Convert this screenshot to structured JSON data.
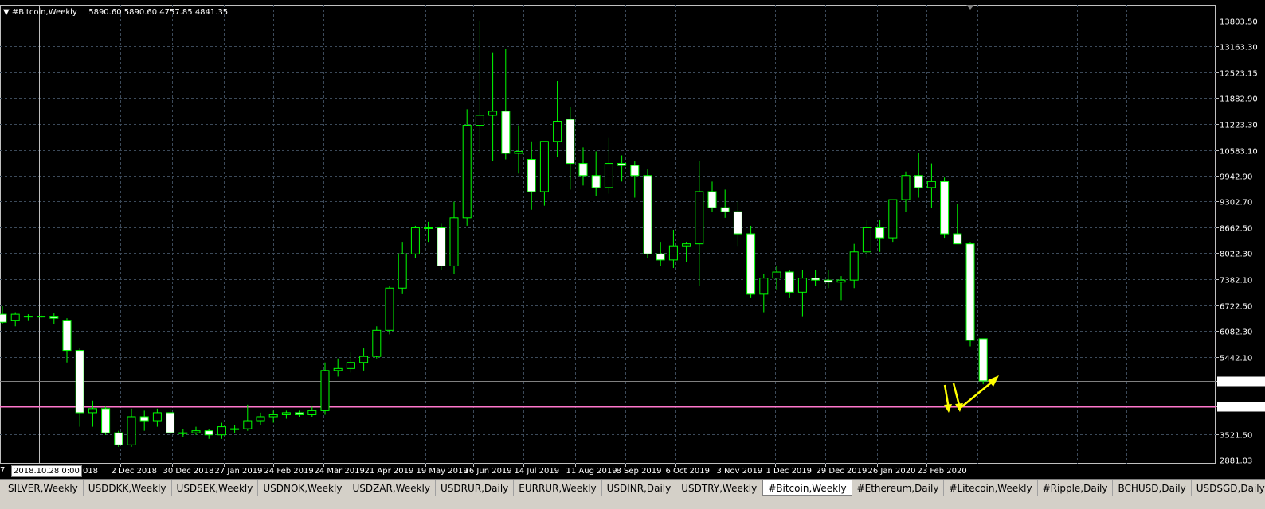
{
  "header": {
    "menu_arrow": "▼",
    "symbol": "#Bitcoin,Weekly",
    "ohlc": "5890.60 5890.60 4757.85 4841.35"
  },
  "crosshair": {
    "time_label": "2018.10.28 0:00",
    "left_cut_label": "7"
  },
  "tabs": [
    {
      "label": "SILVER,Weekly",
      "active": false
    },
    {
      "label": "USDDKK,Weekly",
      "active": false
    },
    {
      "label": "USDSEK,Weekly",
      "active": false
    },
    {
      "label": "USDNOK,Weekly",
      "active": false
    },
    {
      "label": "USDZAR,Weekly",
      "active": false
    },
    {
      "label": "USDRUR,Daily",
      "active": false
    },
    {
      "label": "EURRUR,Weekly",
      "active": false
    },
    {
      "label": "USDINR,Daily",
      "active": false
    },
    {
      "label": "USDTRY,Weekly",
      "active": false
    },
    {
      "label": "#Bitcoin,Weekly",
      "active": true
    },
    {
      "label": "#Ethereum,Daily",
      "active": false
    },
    {
      "label": "#Litecoin,Weekly",
      "active": false
    },
    {
      "label": "#Ripple,Daily",
      "active": false
    },
    {
      "label": "BCHUSD,Daily",
      "active": false
    },
    {
      "label": "USDSGD,Daily",
      "active": false
    }
  ],
  "colors": {
    "background": "#000000",
    "grid": "#3c4a5a",
    "bull_candle": "#000000",
    "bear_candle": "#ffffff",
    "wick": "#00ff00",
    "support_line": "#ff77cc",
    "price_line": "#808080",
    "arrows": "#ffff00"
  },
  "chart_data": {
    "type": "candlestick",
    "symbol": "#Bitcoin",
    "timeframe": "Weekly",
    "ylim": [
      2881.03,
      14000
    ],
    "y_ticks": [
      "13803.50",
      "13163.30",
      "12523.15",
      "11882.90",
      "11223.30",
      "10583.10",
      "9942.90",
      "9302.70",
      "8662.50",
      "8022.30",
      "7382.10",
      "6722.50",
      "6082.30",
      "5442.10",
      "4841.35",
      "4206.83",
      "3521.50",
      "2881.03"
    ],
    "x_ticks": [
      "v 2018",
      "2 Dec 2018",
      "30 Dec 2018",
      "27 Jan 2019",
      "24 Feb 2019",
      "24 Mar 2019",
      "21 Apr 2019",
      "19 May 2019",
      "16 Jun 2019",
      "14 Jul 2019",
      "11 Aug 2019",
      "8 Sep 2019",
      "6 Oct 2019",
      "3 Nov 2019",
      "1 Dec 2019",
      "29 Dec 2019",
      "26 Jan 2020",
      "23 Feb 2020"
    ],
    "current_price": 4841.35,
    "horizontal_line": 4206.83,
    "grid": true,
    "candles": [
      {
        "o": 6500,
        "h": 6700,
        "l": 6250,
        "c": 6300
      },
      {
        "o": 6350,
        "h": 6550,
        "l": 6200,
        "c": 6500
      },
      {
        "o": 6450,
        "h": 6500,
        "l": 6350,
        "c": 6450
      },
      {
        "o": 6450,
        "h": 6500,
        "l": 6400,
        "c": 6430
      },
      {
        "o": 6450,
        "h": 6520,
        "l": 6250,
        "c": 6400
      },
      {
        "o": 6350,
        "h": 6400,
        "l": 5300,
        "c": 5600
      },
      {
        "o": 5600,
        "h": 5650,
        "l": 3700,
        "c": 4050
      },
      {
        "o": 4050,
        "h": 4350,
        "l": 3700,
        "c": 4150
      },
      {
        "o": 4150,
        "h": 4200,
        "l": 3500,
        "c": 3550
      },
      {
        "o": 3550,
        "h": 3600,
        "l": 3200,
        "c": 3250
      },
      {
        "o": 3250,
        "h": 4150,
        "l": 3200,
        "c": 3950
      },
      {
        "o": 3950,
        "h": 4100,
        "l": 3600,
        "c": 3850
      },
      {
        "o": 3850,
        "h": 4150,
        "l": 3700,
        "c": 4050
      },
      {
        "o": 4050,
        "h": 4150,
        "l": 3500,
        "c": 3550
      },
      {
        "o": 3550,
        "h": 3650,
        "l": 3450,
        "c": 3550
      },
      {
        "o": 3550,
        "h": 3700,
        "l": 3500,
        "c": 3600
      },
      {
        "o": 3600,
        "h": 3650,
        "l": 3400,
        "c": 3500
      },
      {
        "o": 3500,
        "h": 3800,
        "l": 3400,
        "c": 3700
      },
      {
        "o": 3650,
        "h": 3750,
        "l": 3550,
        "c": 3650
      },
      {
        "o": 3650,
        "h": 4250,
        "l": 3600,
        "c": 3850
      },
      {
        "o": 3850,
        "h": 4050,
        "l": 3750,
        "c": 3950
      },
      {
        "o": 3950,
        "h": 4100,
        "l": 3800,
        "c": 4000
      },
      {
        "o": 4000,
        "h": 4100,
        "l": 3900,
        "c": 4050
      },
      {
        "o": 4050,
        "h": 4100,
        "l": 3950,
        "c": 4000
      },
      {
        "o": 4000,
        "h": 4200,
        "l": 3950,
        "c": 4100
      },
      {
        "o": 4100,
        "h": 5300,
        "l": 4000,
        "c": 5100
      },
      {
        "o": 5100,
        "h": 5400,
        "l": 4950,
        "c": 5150
      },
      {
        "o": 5150,
        "h": 5550,
        "l": 5050,
        "c": 5300
      },
      {
        "o": 5300,
        "h": 5650,
        "l": 5100,
        "c": 5450
      },
      {
        "o": 5450,
        "h": 6200,
        "l": 5400,
        "c": 6100
      },
      {
        "o": 6100,
        "h": 7200,
        "l": 6000,
        "c": 7150
      },
      {
        "o": 7150,
        "h": 8300,
        "l": 7000,
        "c": 8000
      },
      {
        "o": 8000,
        "h": 8700,
        "l": 7900,
        "c": 8650
      },
      {
        "o": 8650,
        "h": 8800,
        "l": 8300,
        "c": 8650
      },
      {
        "o": 8650,
        "h": 8750,
        "l": 7600,
        "c": 7700
      },
      {
        "o": 7700,
        "h": 9300,
        "l": 7500,
        "c": 8900
      },
      {
        "o": 8900,
        "h": 11600,
        "l": 8700,
        "c": 11200
      },
      {
        "o": 11200,
        "h": 13800,
        "l": 10500,
        "c": 11450
      },
      {
        "o": 11450,
        "h": 13000,
        "l": 10300,
        "c": 11550
      },
      {
        "o": 11550,
        "h": 13100,
        "l": 10350,
        "c": 10500
      },
      {
        "o": 10500,
        "h": 11200,
        "l": 10000,
        "c": 10550
      },
      {
        "o": 10350,
        "h": 10800,
        "l": 9100,
        "c": 9550
      },
      {
        "o": 9550,
        "h": 10800,
        "l": 9200,
        "c": 10800
      },
      {
        "o": 10800,
        "h": 12300,
        "l": 10400,
        "c": 11300
      },
      {
        "o": 11350,
        "h": 11650,
        "l": 9600,
        "c": 10250
      },
      {
        "o": 10250,
        "h": 10650,
        "l": 9700,
        "c": 9950
      },
      {
        "o": 9950,
        "h": 10550,
        "l": 9450,
        "c": 9650
      },
      {
        "o": 9650,
        "h": 10900,
        "l": 9500,
        "c": 10250
      },
      {
        "o": 10250,
        "h": 10450,
        "l": 9800,
        "c": 10200
      },
      {
        "o": 10200,
        "h": 10300,
        "l": 9400,
        "c": 9950
      },
      {
        "o": 9950,
        "h": 10100,
        "l": 7900,
        "c": 8000
      },
      {
        "o": 8000,
        "h": 8300,
        "l": 7700,
        "c": 7850
      },
      {
        "o": 7850,
        "h": 8600,
        "l": 7650,
        "c": 8200
      },
      {
        "o": 8200,
        "h": 8300,
        "l": 7800,
        "c": 8250
      },
      {
        "o": 8250,
        "h": 10300,
        "l": 7200,
        "c": 9550
      },
      {
        "o": 9550,
        "h": 9800,
        "l": 9050,
        "c": 9150
      },
      {
        "o": 9150,
        "h": 9600,
        "l": 8900,
        "c": 9050
      },
      {
        "o": 9050,
        "h": 9300,
        "l": 8200,
        "c": 8500
      },
      {
        "o": 8500,
        "h": 8700,
        "l": 6900,
        "c": 7000
      },
      {
        "o": 7000,
        "h": 7500,
        "l": 6550,
        "c": 7400
      },
      {
        "o": 7400,
        "h": 7700,
        "l": 7100,
        "c": 7550
      },
      {
        "o": 7550,
        "h": 7600,
        "l": 6900,
        "c": 7050
      },
      {
        "o": 7050,
        "h": 7600,
        "l": 6450,
        "c": 7400
      },
      {
        "o": 7400,
        "h": 7600,
        "l": 7200,
        "c": 7350
      },
      {
        "o": 7350,
        "h": 7600,
        "l": 7150,
        "c": 7300
      },
      {
        "o": 7300,
        "h": 7450,
        "l": 6850,
        "c": 7350
      },
      {
        "o": 7350,
        "h": 8250,
        "l": 7150,
        "c": 8050
      },
      {
        "o": 8050,
        "h": 8850,
        "l": 7900,
        "c": 8650
      },
      {
        "o": 8650,
        "h": 8850,
        "l": 8050,
        "c": 8400
      },
      {
        "o": 8400,
        "h": 9350,
        "l": 8300,
        "c": 9350
      },
      {
        "o": 9350,
        "h": 10050,
        "l": 9050,
        "c": 9950
      },
      {
        "o": 9950,
        "h": 10500,
        "l": 9400,
        "c": 9650
      },
      {
        "o": 9650,
        "h": 10250,
        "l": 9150,
        "c": 9800
      },
      {
        "o": 9800,
        "h": 9900,
        "l": 8400,
        "c": 8500
      },
      {
        "o": 8500,
        "h": 9250,
        "l": 8300,
        "c": 8250
      },
      {
        "o": 8250,
        "h": 8300,
        "l": 5700,
        "c": 5850
      },
      {
        "o": 5890.6,
        "h": 5890.6,
        "l": 4757.85,
        "c": 4841.35
      }
    ]
  }
}
